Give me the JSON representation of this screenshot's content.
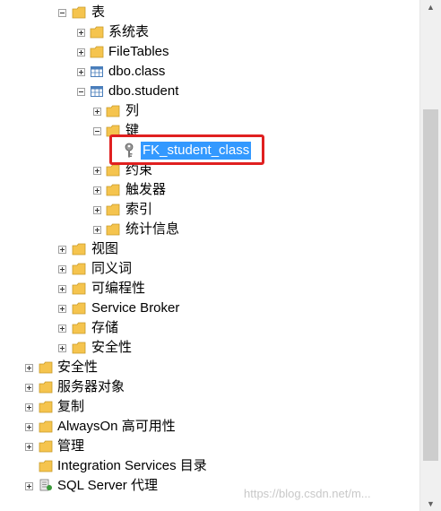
{
  "tree": {
    "items": [
      {
        "label": "表",
        "expander": "minus",
        "icon": "folder-icon"
      },
      {
        "label": "系统表",
        "expander": "plus",
        "icon": "folder-icon"
      },
      {
        "label": "FileTables",
        "expander": "plus",
        "icon": "folder-icon"
      },
      {
        "label": "dbo.class",
        "expander": "plus",
        "icon": "table-icon"
      },
      {
        "label": "dbo.student",
        "expander": "minus",
        "icon": "table-icon"
      },
      {
        "label": "列",
        "expander": "plus",
        "icon": "folder-icon"
      },
      {
        "label": "键",
        "expander": "minus",
        "icon": "folder-icon"
      },
      {
        "label": "FK_student_class",
        "expander": "none",
        "icon": "key-icon",
        "selected": true
      },
      {
        "label": "约束",
        "expander": "plus",
        "icon": "folder-icon"
      },
      {
        "label": "触发器",
        "expander": "plus",
        "icon": "folder-icon"
      },
      {
        "label": "索引",
        "expander": "plus",
        "icon": "folder-icon"
      },
      {
        "label": "统计信息",
        "expander": "plus",
        "icon": "folder-icon"
      },
      {
        "label": "视图",
        "expander": "plus",
        "icon": "folder-icon"
      },
      {
        "label": "同义词",
        "expander": "plus",
        "icon": "folder-icon"
      },
      {
        "label": "可编程性",
        "expander": "plus",
        "icon": "folder-icon"
      },
      {
        "label": "Service Broker",
        "expander": "plus",
        "icon": "folder-icon"
      },
      {
        "label": "存储",
        "expander": "plus",
        "icon": "folder-icon"
      },
      {
        "label": "安全性",
        "expander": "plus",
        "icon": "folder-icon"
      },
      {
        "label": "安全性",
        "expander": "plus",
        "icon": "folder-icon"
      },
      {
        "label": "服务器对象",
        "expander": "plus",
        "icon": "folder-icon"
      },
      {
        "label": "复制",
        "expander": "plus",
        "icon": "folder-icon"
      },
      {
        "label": "AlwaysOn 高可用性",
        "expander": "plus",
        "icon": "folder-icon"
      },
      {
        "label": "管理",
        "expander": "plus",
        "icon": "folder-icon"
      },
      {
        "label": "Integration Services 目录",
        "expander": "none",
        "icon": "folder-icon"
      },
      {
        "label": "SQL Server 代理",
        "expander": "plus",
        "icon": "agent-icon"
      }
    ]
  },
  "scrollbar": {
    "up_icon": "arrow-up-icon",
    "down_icon": "arrow-down-icon"
  },
  "watermark": "https://blog.csdn.net/m...",
  "colors": {
    "selection": "#3399ff",
    "highlight_box": "#e02020",
    "folder": "#f5c44e",
    "folder_edge": "#c89b2a"
  }
}
